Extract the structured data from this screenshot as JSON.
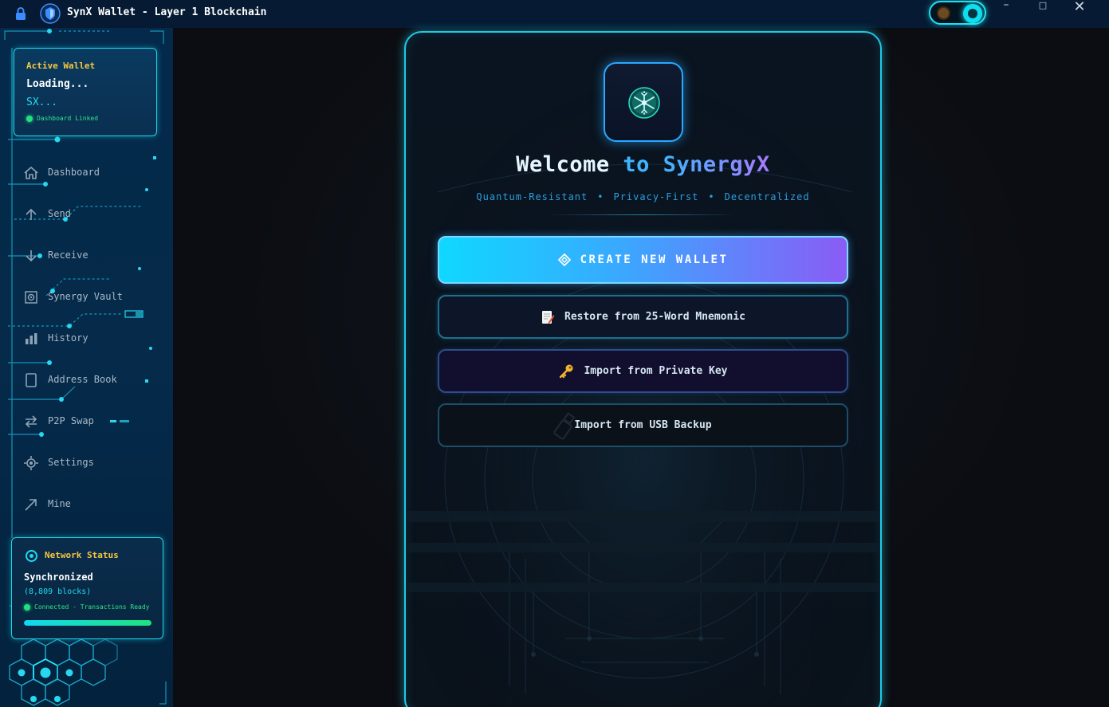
{
  "window": {
    "title": "SynX Wallet - Layer 1 Blockchain",
    "minimize_glyph": "–",
    "maximize_glyph": "□",
    "close_glyph": "✕"
  },
  "sidebar": {
    "active_wallet": {
      "title": "Active Wallet",
      "name": "Loading...",
      "address": "SX...",
      "status": "Dashboard Linked"
    },
    "items": [
      {
        "label": "Dashboard",
        "icon": "home-icon"
      },
      {
        "label": "Send",
        "icon": "arrow-up-icon"
      },
      {
        "label": "Receive",
        "icon": "arrow-down-icon"
      },
      {
        "label": "Synergy Vault",
        "icon": "vault-icon"
      },
      {
        "label": "History",
        "icon": "bar-chart-icon"
      },
      {
        "label": "Address Book",
        "icon": "book-icon"
      },
      {
        "label": "P2P Swap",
        "icon": "swap-icon"
      },
      {
        "label": "Settings",
        "icon": "gear-icon"
      },
      {
        "label": "Mine",
        "icon": "trend-arrow-icon"
      }
    ],
    "network": {
      "title": "Network Status",
      "state": "Synchronized",
      "blocks": "(8,809 blocks)",
      "connection": "Connected - Transactions Ready",
      "sync_progress": 1.0
    }
  },
  "main": {
    "welcome": {
      "w1": "Welcome",
      "w2": "to",
      "w3": "SynergyX"
    },
    "tagline": [
      "Quantum-Resistant",
      "Privacy-First",
      "Decentralized"
    ],
    "tagline_separator": "•",
    "buttons": {
      "create": "CREATE NEW WALLET",
      "restore": "Restore from 25-Word Mnemonic",
      "private_key": "Import from Private Key",
      "usb": "Import from USB Backup"
    }
  },
  "colors": {
    "accent_cyan": "#1fd6ea",
    "accent_gold": "#f5c842",
    "accent_green": "#21e07d",
    "accent_purple": "#8a5cf6",
    "sidebar_bg": "#04294a"
  }
}
